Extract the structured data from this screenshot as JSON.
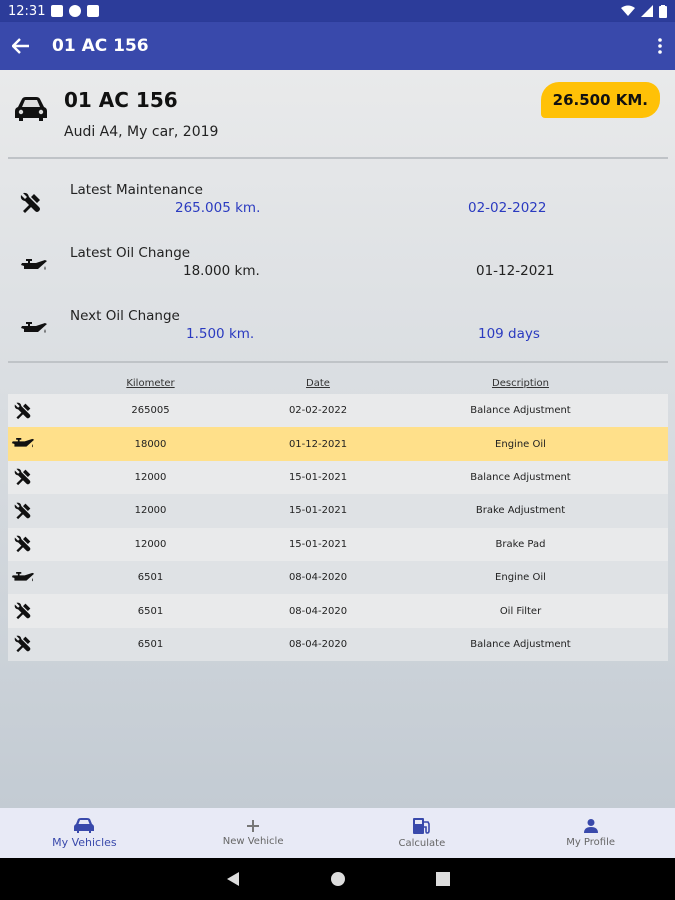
{
  "status_bar": {
    "time": "12:31"
  },
  "app_bar": {
    "title": "01 AC 156"
  },
  "vehicle": {
    "plate": "01 AC 156",
    "description": "Audi A4, My car, 2019",
    "km_badge": "26.500 KM."
  },
  "summary": {
    "latest_maintenance": {
      "label": "Latest Maintenance",
      "km": "265.005 km.",
      "date": "02-02-2022"
    },
    "latest_oil_change": {
      "label": "Latest Oil Change",
      "km": "18.000 km.",
      "date": "01-12-2021"
    },
    "next_oil_change": {
      "label": "Next Oil Change",
      "km": "1.500 km.",
      "days": "109 days"
    }
  },
  "history": {
    "headers": {
      "km": "Kilometer",
      "date": "Date",
      "description": "Description"
    },
    "rows": [
      {
        "icon": "wrench-icon",
        "km": "265005",
        "date": "02-02-2022",
        "description": "Balance Adjustment"
      },
      {
        "icon": "oil-can-icon",
        "km": "18000",
        "date": "01-12-2021",
        "description": "Engine Oil"
      },
      {
        "icon": "wrench-icon",
        "km": "12000",
        "date": "15-01-2021",
        "description": "Balance Adjustment"
      },
      {
        "icon": "wrench-icon",
        "km": "12000",
        "date": "15-01-2021",
        "description": "Brake Adjustment"
      },
      {
        "icon": "wrench-icon",
        "km": "12000",
        "date": "15-01-2021",
        "description": "Brake Pad"
      },
      {
        "icon": "oil-can-icon",
        "km": "6501",
        "date": "08-04-2020",
        "description": "Engine Oil"
      },
      {
        "icon": "wrench-icon",
        "km": "6501",
        "date": "08-04-2020",
        "description": "Oil Filter"
      },
      {
        "icon": "wrench-icon",
        "km": "6501",
        "date": "08-04-2020",
        "description": "Balance Adjustment"
      }
    ]
  },
  "bottom_nav": {
    "items": [
      {
        "label": "My Vehicles",
        "icon": "car-icon"
      },
      {
        "label": "New Vehicle",
        "icon": "plus-icon"
      },
      {
        "label": "Calculate",
        "icon": "fuel-pump-icon"
      },
      {
        "label": "My Profile",
        "icon": "person-icon"
      }
    ]
  },
  "colors": {
    "primary": "#3949ab",
    "status_bar": "#2c3c9a",
    "accent_fab": "#f57c1f",
    "badge": "#ffc107",
    "value_blue": "#2b3bc0",
    "highlight_row": "#ffe08a"
  }
}
